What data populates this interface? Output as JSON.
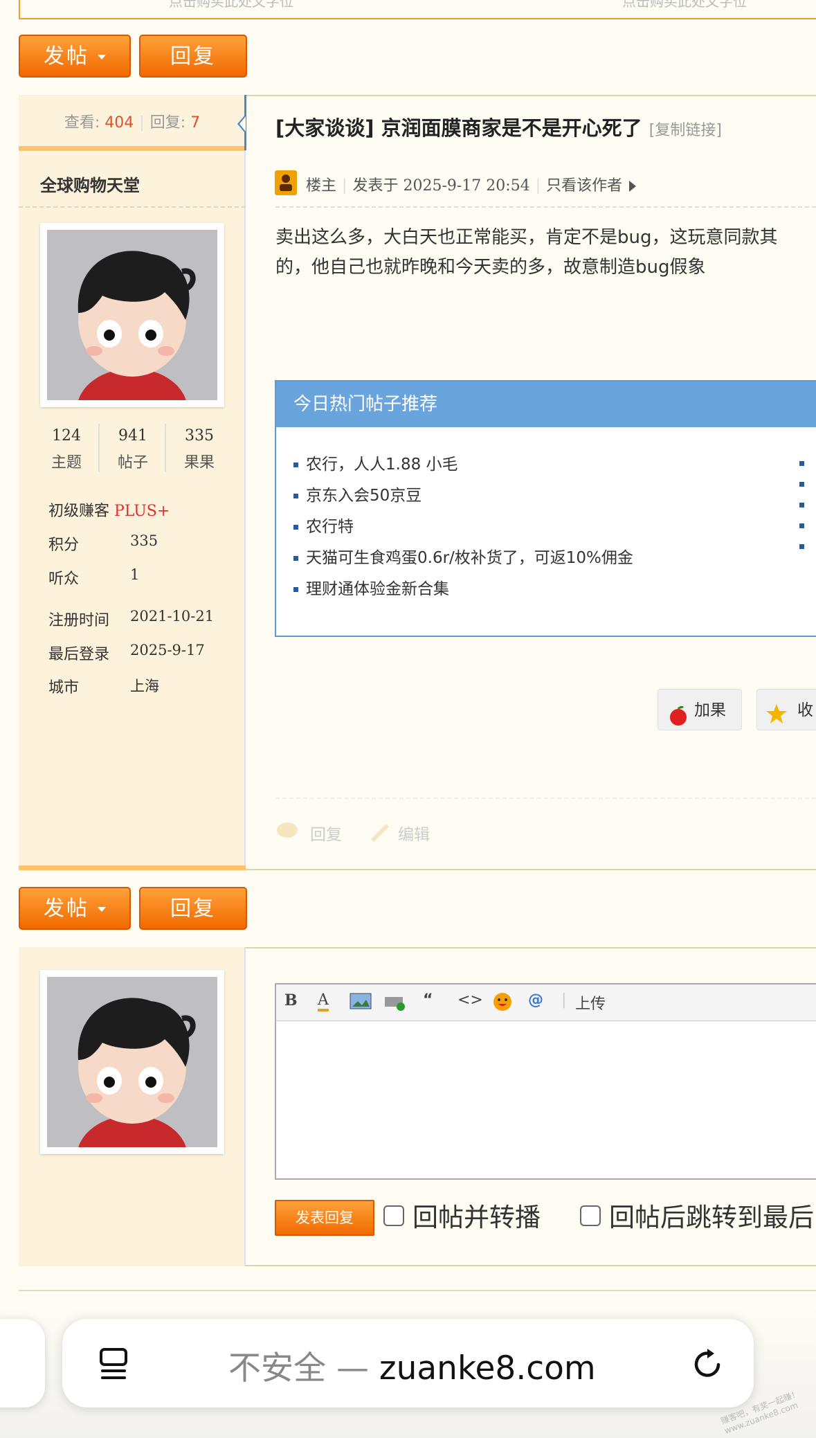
{
  "ad": {
    "left": "点击购买此处文字位",
    "right": "点击购买此处文字位"
  },
  "actions": {
    "post_label": "发帖",
    "reply_label": "回复"
  },
  "thread": {
    "views_label": "查看:",
    "views": "404",
    "replies_label": "回复:",
    "replies": "7",
    "category": "[大家谈谈]",
    "title": "京润面膜商家是不是开心死了",
    "copy_link": "[复制链接]"
  },
  "author": {
    "name": "全球购物天堂",
    "stats": [
      {
        "value": "124",
        "label": "主题"
      },
      {
        "value": "941",
        "label": "帖子"
      },
      {
        "value": "335",
        "label": "果果"
      }
    ],
    "rank": "初级赚客",
    "rank_badge": "PLUS+",
    "points_label": "积分",
    "points": "335",
    "followers_label": "听众",
    "followers": "1",
    "reg_label": "注册时间",
    "reg_date": "2021-10-21",
    "last_label": "最后登录",
    "last_login": "2025-9-17",
    "city_label": "城市",
    "city": "上海"
  },
  "post": {
    "role": "楼主",
    "posted_label": "发表于",
    "posted_at": "2025-9-17 20:54",
    "only_author": "只看该作者",
    "content": "卖出这么多，大白天也正常能买，肯定不是bug，这玩意同款其\n的，他自己也就昨晚和今天卖的多，故意制造bug假象"
  },
  "hot": {
    "header": "今日热门帖子推荐",
    "items": [
      "农行，人人1.88 小毛",
      "京东入会50京豆",
      "农行特",
      "天猫可生食鸡蛋0.6r/枚补货了，可返10%佣金",
      "理财通体验金新合集"
    ]
  },
  "post_actions": {
    "add_fruit": "加果",
    "favorite": "收",
    "reply": "回复",
    "edit": "编辑"
  },
  "editor": {
    "toolbar": {
      "bold": "B",
      "font_color": "A",
      "quote": "“",
      "code": "<>",
      "mention": "@",
      "upload": "上传"
    },
    "submit": "发表回复",
    "opt1": "回帖并转播",
    "opt2": "回帖后跳转到最后"
  },
  "browser": {
    "insecure": "不安全",
    "dash": "—",
    "domain": "zuanke8.com"
  },
  "watermark": "赚客吧，有奖一起赚！ www.zuanke8.com"
}
